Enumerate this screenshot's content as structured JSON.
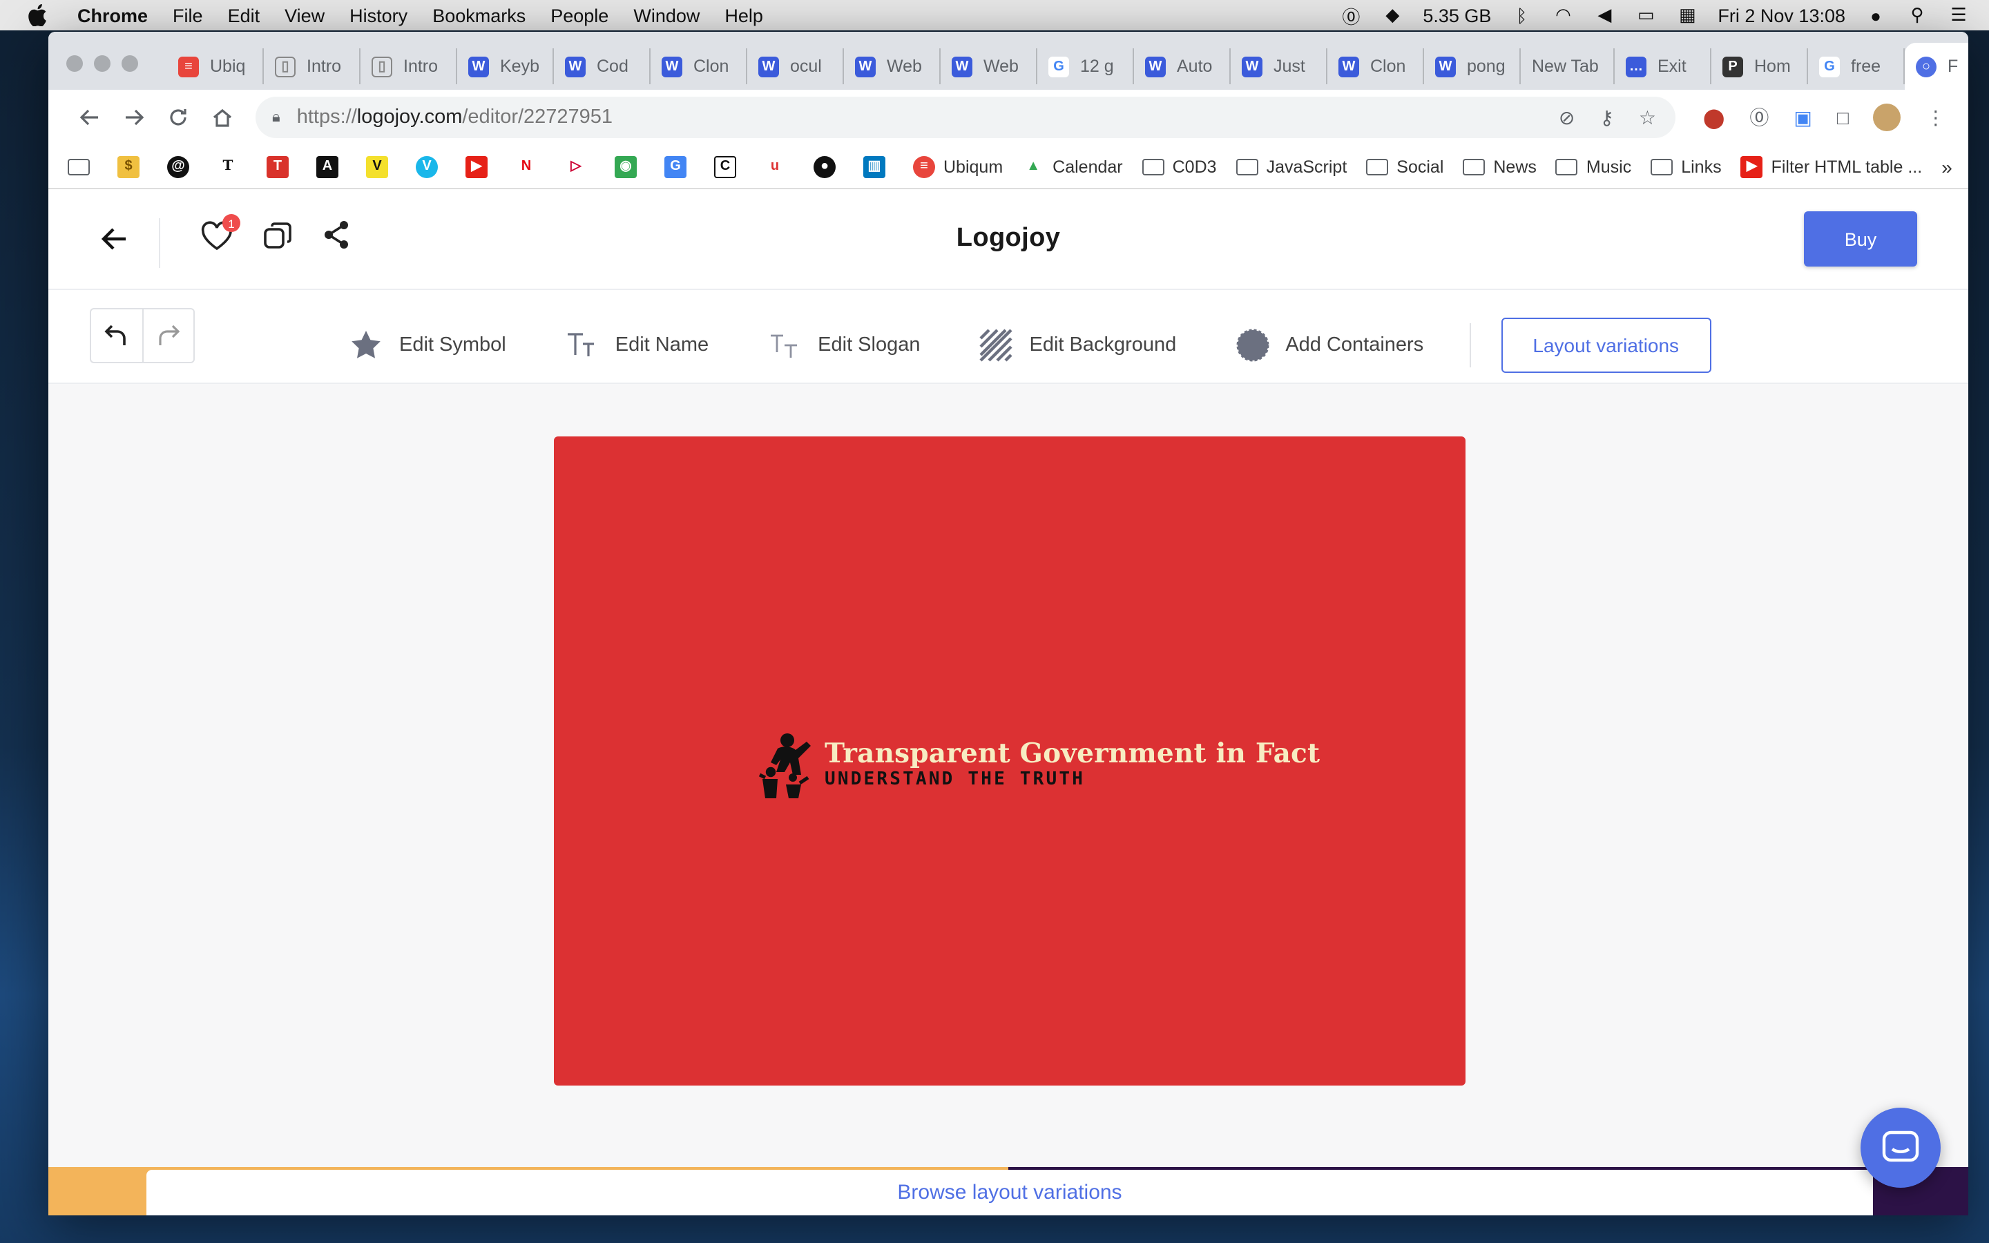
{
  "menubar": {
    "app": "Chrome",
    "items": [
      "File",
      "Edit",
      "View",
      "History",
      "Bookmarks",
      "People",
      "Window",
      "Help"
    ],
    "storage": "5.35 GB",
    "datetime": "Fri 2 Nov  13:08"
  },
  "tabs": [
    {
      "label": "Ubiq",
      "icon": "ubiqum-icon",
      "color": "#e8453c"
    },
    {
      "label": "Intro",
      "icon": "page-icon",
      "color": "#888888"
    },
    {
      "label": "Intro",
      "icon": "page-icon",
      "color": "#888888"
    },
    {
      "label": "Keyb",
      "icon": "w-icon",
      "color": "#3b5bdb"
    },
    {
      "label": "Cod",
      "icon": "w-icon",
      "color": "#3b5bdb"
    },
    {
      "label": "Clon",
      "icon": "w-icon",
      "color": "#3b5bdb"
    },
    {
      "label": "ocul",
      "icon": "w-icon",
      "color": "#3b5bdb"
    },
    {
      "label": "Web",
      "icon": "w-icon",
      "color": "#3b5bdb"
    },
    {
      "label": "Web",
      "icon": "w-icon",
      "color": "#3b5bdb"
    },
    {
      "label": "12 g",
      "icon": "google-icon",
      "color": "#4285f4"
    },
    {
      "label": "Auto",
      "icon": "w-icon",
      "color": "#3b5bdb"
    },
    {
      "label": "Just",
      "icon": "w-icon",
      "color": "#3b5bdb"
    },
    {
      "label": "Clon",
      "icon": "w-icon",
      "color": "#3b5bdb"
    },
    {
      "label": "pong",
      "icon": "w-icon",
      "color": "#3b5bdb"
    },
    {
      "label": "New Tab",
      "icon": "",
      "color": ""
    },
    {
      "label": "Exit",
      "icon": "chat-icon",
      "color": "#3b5bdb"
    },
    {
      "label": "Hom",
      "icon": "p-icon",
      "color": "#333333"
    },
    {
      "label": "free",
      "icon": "google-icon",
      "color": "#4285f4"
    },
    {
      "label": "F",
      "icon": "logojoy-icon",
      "color": "#4f6fe4",
      "active": true
    }
  ],
  "address": {
    "scheme": "https://",
    "host": "logojoy.com",
    "path": "/editor/22727951"
  },
  "bookmarks": {
    "items": [
      "Ubiqum",
      "Calendar",
      "C0D3",
      "JavaScript",
      "Social",
      "News",
      "Music",
      "Links",
      "Filter HTML table ..."
    ],
    "more": "»"
  },
  "header": {
    "brand": "Logojoy",
    "favorites_count": "1",
    "buy_label": "Buy"
  },
  "edit_bar": {
    "edit_symbol": "Edit Symbol",
    "edit_name": "Edit Name",
    "edit_slogan": "Edit Slogan",
    "edit_background": "Edit Background",
    "add_containers": "Add Containers",
    "layout_variations": "Layout variations"
  },
  "logo": {
    "name": "Transparent Government in Fact",
    "slogan": "UNDERSTAND THE TRUTH",
    "background_color": "#dc3133",
    "name_color": "#f7ecc2",
    "slogan_color": "#111111"
  },
  "bottom": {
    "browse_label": "Browse layout variations"
  },
  "colors": {
    "accent": "#4f6fe4",
    "badge": "#ef4c4c"
  }
}
